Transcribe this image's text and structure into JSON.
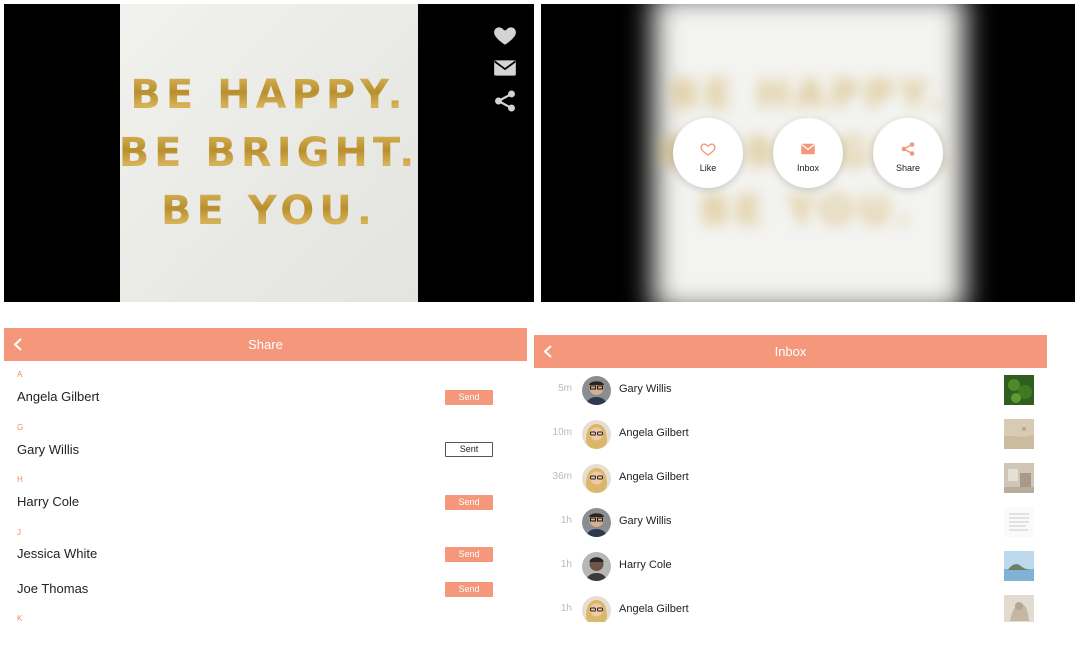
{
  "viewer": {
    "poster_lines": [
      "BE HAPPY.",
      "BE BRIGHT.",
      "BE YOU."
    ],
    "icons": [
      "heart-icon",
      "envelope-icon",
      "share-icon"
    ]
  },
  "action_menu": {
    "buttons": [
      {
        "label": "Like",
        "icon": "heart-outline-icon"
      },
      {
        "label": "Inbox",
        "icon": "envelope-icon"
      },
      {
        "label": "Share",
        "icon": "share-icon"
      }
    ]
  },
  "share": {
    "title": "Share",
    "sections": [
      {
        "letter": "A",
        "contacts": [
          {
            "name": "Angela Gilbert",
            "button": "Send"
          }
        ]
      },
      {
        "letter": "G",
        "contacts": [
          {
            "name": "Gary Willis",
            "button": "Sent"
          }
        ]
      },
      {
        "letter": "H",
        "contacts": [
          {
            "name": "Harry Cole",
            "button": "Send"
          }
        ]
      },
      {
        "letter": "J",
        "contacts": [
          {
            "name": "Jessica White",
            "button": "Send"
          },
          {
            "name": "Joe Thomas",
            "button": "Send"
          }
        ]
      },
      {
        "letter": "K",
        "contacts": []
      }
    ]
  },
  "inbox": {
    "title": "Inbox",
    "rows": [
      {
        "time": "5m",
        "name": "Gary Willis",
        "thumb": "green-foliage"
      },
      {
        "time": "10m",
        "name": "Angela Gilbert",
        "thumb": "sand-beach"
      },
      {
        "time": "36m",
        "name": "Angela Gilbert",
        "thumb": "interior-room"
      },
      {
        "time": "1h",
        "name": "Gary Willis",
        "thumb": "text-page"
      },
      {
        "time": "1h",
        "name": "Harry Cole",
        "thumb": "sea-island"
      },
      {
        "time": "1h",
        "name": "Angela Gilbert",
        "thumb": "stone-sculpture"
      }
    ]
  },
  "colors": {
    "accent": "#f4977a",
    "section_letter": "#f08a63",
    "gold": "#c7a140"
  }
}
